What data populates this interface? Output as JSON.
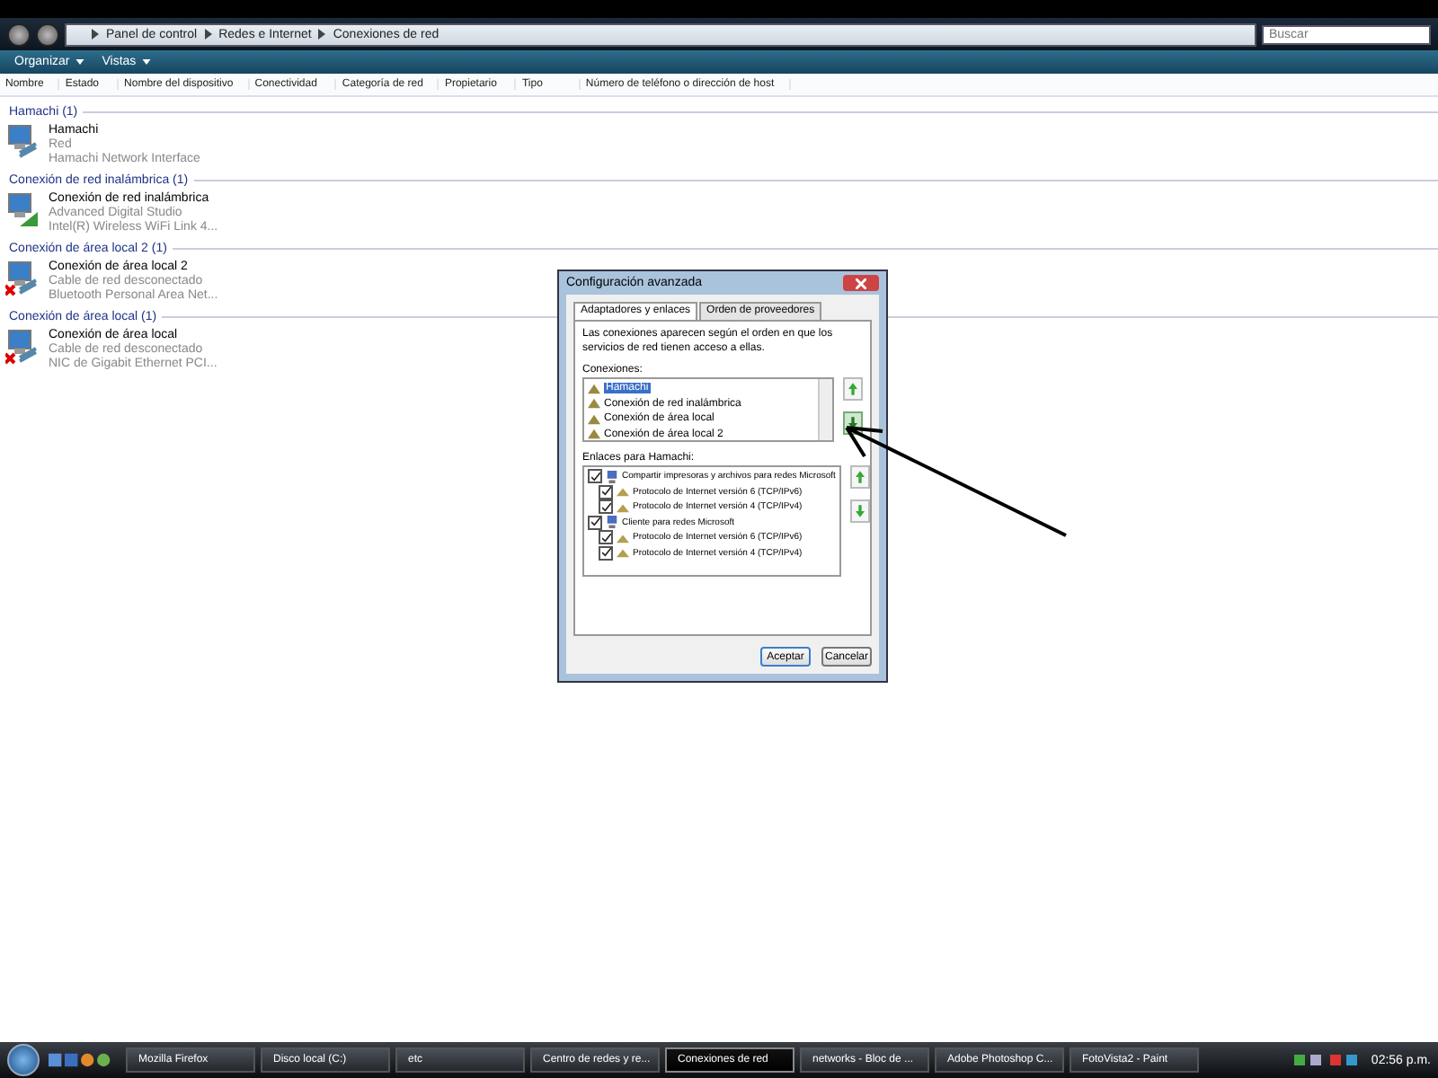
{
  "address_bar": {
    "breadcrumbs": [
      "Panel de control",
      "Redes e Internet",
      "Conexiones de red"
    ],
    "search": {
      "placeholder": "Buscar"
    }
  },
  "toolbar": [
    "Organizar",
    "Vistas"
  ],
  "columns": [
    "Nombre",
    "Estado",
    "Nombre del dispositivo",
    "Conectividad",
    "Categoría de red",
    "Propietario",
    "Tipo",
    "Número de teléfono o dirección de host"
  ],
  "groups": [
    {
      "header": "Hamachi (1)",
      "items": [
        {
          "name": "Hamachi",
          "status": "Red",
          "device": "Hamachi Network Interface",
          "kind": "wired",
          "disconnected": false
        }
      ]
    },
    {
      "header": "Conexión de red inalámbrica (1)",
      "items": [
        {
          "name": "Conexión de red inalámbrica",
          "status": "Advanced Digital Studio",
          "device": "Intel(R) Wireless WiFi Link 4...",
          "kind": "wireless",
          "disconnected": false
        }
      ]
    },
    {
      "header": "Conexión de área local 2 (1)",
      "items": [
        {
          "name": "Conexión de área local 2",
          "status": "Cable de red desconectado",
          "device": "Bluetooth Personal Area Net...",
          "kind": "wired",
          "disconnected": true
        }
      ]
    },
    {
      "header": "Conexión de área local (1)",
      "items": [
        {
          "name": "Conexión de área local",
          "status": "Cable de red desconectado",
          "device": "NIC de Gigabit Ethernet PCI...",
          "kind": "wired",
          "disconnected": true
        }
      ]
    }
  ],
  "dialog": {
    "title": "Configuración avanzada",
    "tabs": [
      {
        "label": "Adaptadores y enlaces",
        "selected": true
      },
      {
        "label": "Orden de proveedores",
        "selected": false
      }
    ],
    "description": "Las conexiones aparecen según el orden en que los servicios de red tienen acceso a ellas.",
    "connections_label": "Conexiones:",
    "connections": [
      {
        "label": "Hamachi",
        "selected": true
      },
      {
        "label": "Conexión de red inalámbrica",
        "selected": false
      },
      {
        "label": "Conexión de área local",
        "selected": false
      },
      {
        "label": "Conexión de área local 2",
        "selected": false
      }
    ],
    "bindings_label": "Enlaces para Hamachi:",
    "bindings": [
      {
        "label": "Compartir impresoras y archivos para redes Microsoft",
        "checked": true,
        "children": [
          {
            "label": "Protocolo de Internet versión 6 (TCP/IPv6)",
            "checked": true
          },
          {
            "label": "Protocolo de Internet versión 4 (TCP/IPv4)",
            "checked": true
          }
        ]
      },
      {
        "label": "Cliente para redes Microsoft",
        "checked": true,
        "children": [
          {
            "label": "Protocolo de Internet versión 6 (TCP/IPv6)",
            "checked": true
          },
          {
            "label": "Protocolo de Internet versión 4 (TCP/IPv4)",
            "checked": true
          }
        ]
      }
    ],
    "buttons": [
      "Aceptar",
      "Cancelar"
    ]
  },
  "taskbar": {
    "tasks": [
      {
        "label": "Mozilla Firefox",
        "selected": false
      },
      {
        "label": "Disco local (C:)",
        "selected": false
      },
      {
        "label": "etc",
        "selected": false
      },
      {
        "label": "Centro de redes y re...",
        "selected": false
      },
      {
        "label": "Conexiones de red",
        "selected": true
      },
      {
        "label": "networks - Bloc de ...",
        "selected": false
      },
      {
        "label": "Adobe Photoshop C...",
        "selected": false
      },
      {
        "label": "FotoVista2 - Paint",
        "selected": false
      }
    ],
    "clock": "02:56 p.m."
  }
}
